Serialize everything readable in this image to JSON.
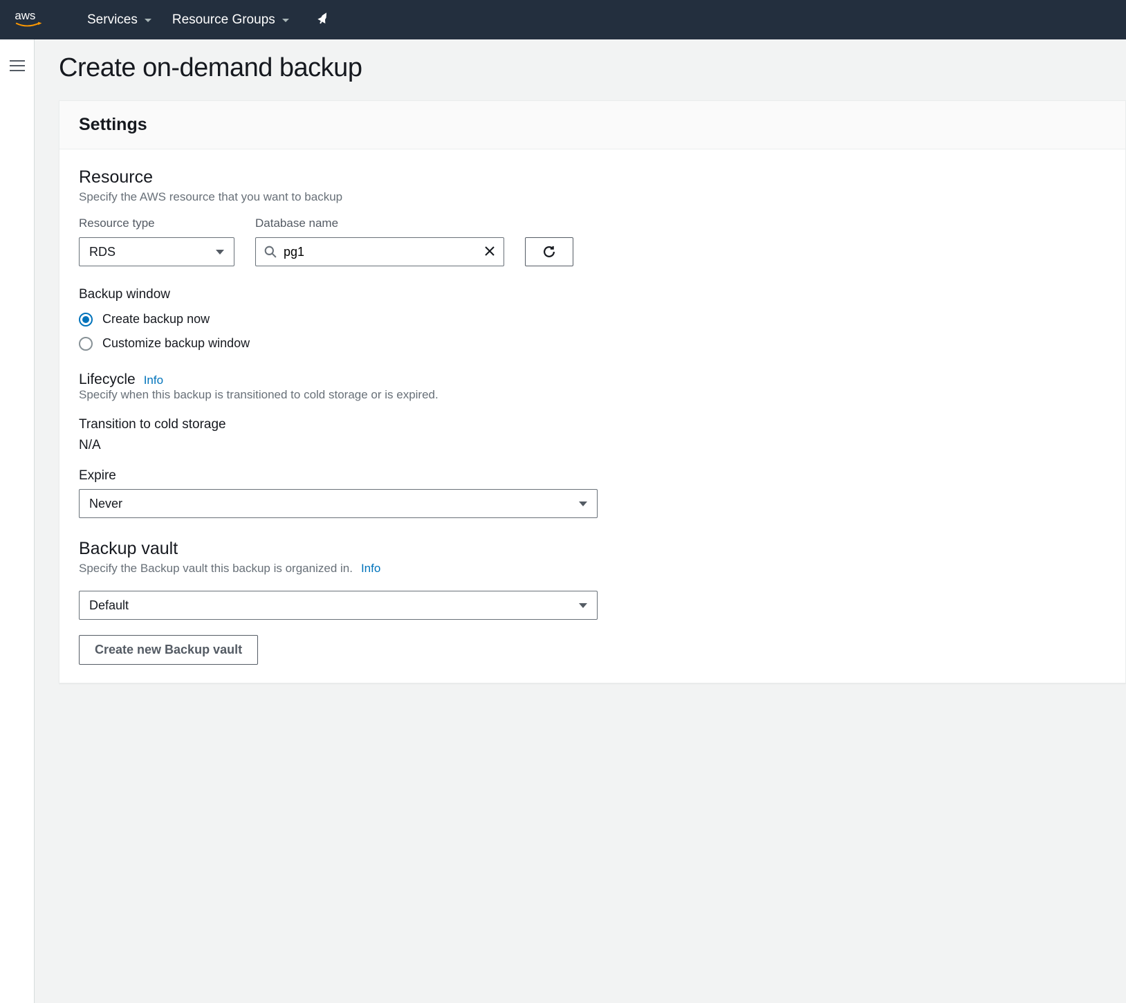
{
  "nav": {
    "services": "Services",
    "resource_groups": "Resource Groups"
  },
  "page": {
    "title": "Create on-demand backup"
  },
  "panel": {
    "header": "Settings"
  },
  "resource": {
    "title": "Resource",
    "subtitle": "Specify the AWS resource that you want to backup",
    "type_label": "Resource type",
    "type_value": "RDS",
    "db_label": "Database name",
    "db_value": "pg1"
  },
  "backup_window": {
    "label": "Backup window",
    "opt_now": "Create backup now",
    "opt_custom": "Customize backup window"
  },
  "lifecycle": {
    "title": "Lifecycle",
    "info": "Info",
    "subtitle": "Specify when this backup is transitioned to cold storage or is expired.",
    "cold_label": "Transition to cold storage",
    "cold_value": "N/A",
    "expire_label": "Expire",
    "expire_value": "Never"
  },
  "vault": {
    "title": "Backup vault",
    "subtitle": "Specify the Backup vault this backup is organized in.",
    "info": "Info",
    "value": "Default",
    "create_button": "Create new Backup vault"
  }
}
